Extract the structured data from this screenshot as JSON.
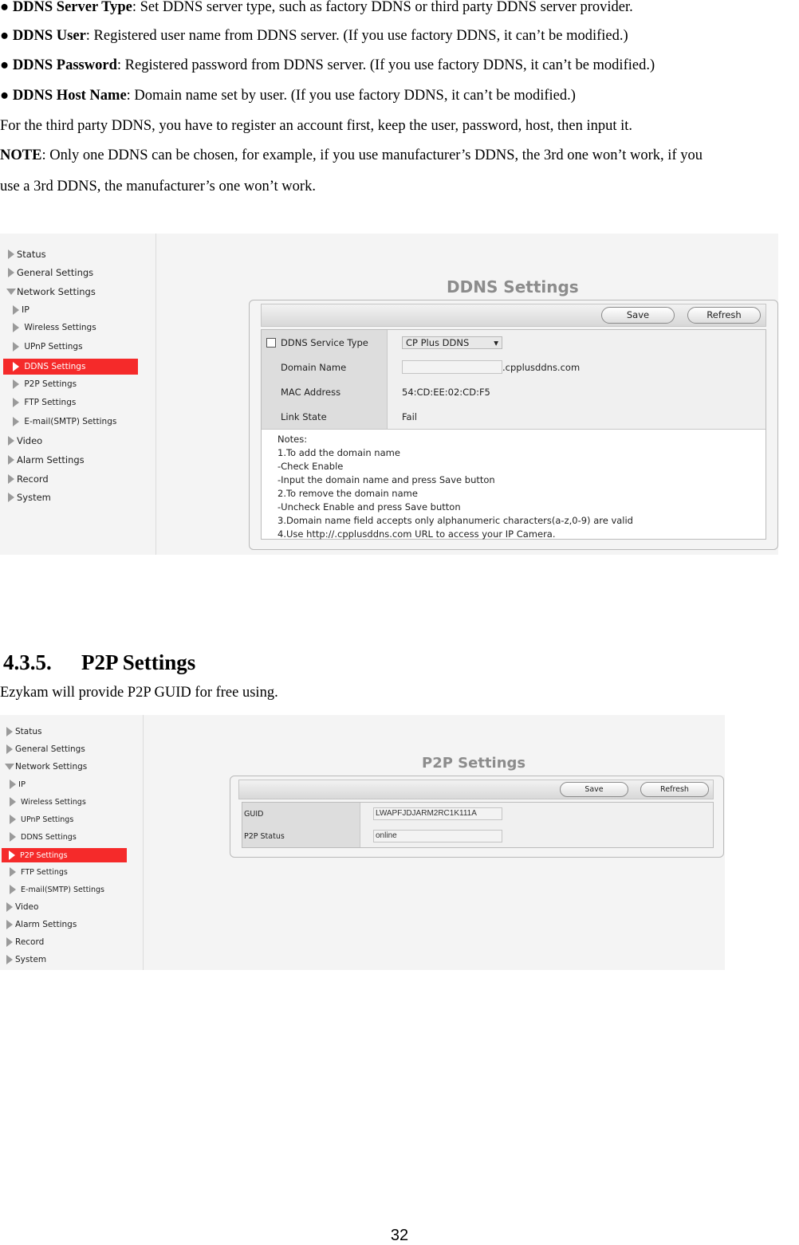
{
  "bullets": [
    {
      "term": "DDNS Server Type",
      "text": ": Set DDNS server type, such as factory DDNS or third party DDNS server provider."
    },
    {
      "term": "DDNS User",
      "text": ": Registered user name from DDNS server. (If you use factory DDNS, it can’t be modified.)"
    },
    {
      "term": "DDNS Password",
      "text": ": Registered password from DDNS server. (If you use factory DDNS, it can’t be modified.)"
    },
    {
      "term": "DDNS Host Name",
      "text": ": Domain name set by user. (If you use factory DDNS, it can’t be modified.)"
    }
  ],
  "bullet_symbol": "●",
  "third_party_text": "For the third party DDNS, you have to register an account first, keep the user, password, host, then input it.",
  "note": {
    "label": "NOTE",
    "text1": ": Only one DDNS can be chosen, for example, if you use manufacturer’s DDNS, the 3rd one won’t work, if you",
    "text2": "use a 3rd DDNS, the manufacturer’s one won’t work."
  },
  "nav": {
    "status": "Status",
    "general": "General Settings",
    "network": "Network Settings",
    "ip": "IP",
    "wireless": "Wireless Settings",
    "upnp": "UPnP Settings",
    "ddns": "DDNS Settings",
    "p2p": "P2P Settings",
    "ftp": "FTP Settings",
    "email": "E-mail(SMTP) Settings",
    "video": "Video",
    "alarm": "Alarm Settings",
    "record": "Record",
    "system": "System"
  },
  "ddns_panel": {
    "title": "DDNS Settings",
    "save": "Save",
    "refresh": "Refresh",
    "service_type_label": "DDNS Service Type",
    "service_type_value": "CP Plus DDNS",
    "domain_label": "Domain Name",
    "domain_value": "",
    "domain_suffix": ".cpplusddns.com",
    "mac_label": "MAC Address",
    "mac_value": "54:CD:EE:02:CD:F5",
    "link_label": "Link State",
    "link_value": "Fail",
    "notes": [
      "Notes:",
      "1.To add the domain name",
      "-Check Enable",
      "-Input the domain name and press Save button",
      "2.To remove the domain name",
      "-Uncheck Enable and press Save button",
      "3.Domain name field accepts only alphanumeric characters(a-z,0-9) are valid",
      "4.Use http://.cpplusddns.com URL to access your IP Camera."
    ]
  },
  "section": {
    "number": "4.3.5.",
    "title": "P2P Settings",
    "intro": "Ezykam will provide P2P GUID for free using."
  },
  "p2p_panel": {
    "title": "P2P Settings",
    "save": "Save",
    "refresh": "Refresh",
    "guid_label": "GUID",
    "guid_value": "LWAPFJDJARM2RC1K111A",
    "status_label": "P2P Status",
    "status_value": "online"
  },
  "page_number": "32"
}
